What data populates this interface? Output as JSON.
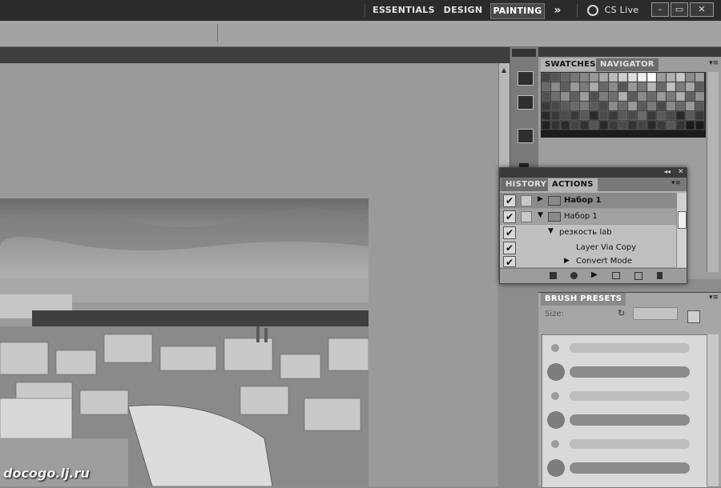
{
  "workspace": {
    "buttons": [
      {
        "label": "ESSENTIALS"
      },
      {
        "label": "DESIGN"
      },
      {
        "label": "PAINTING"
      }
    ],
    "overflow": "»",
    "cslive": "CS Live",
    "window_controls": {
      "minimize": "–",
      "restore": "▭",
      "close": "✕"
    }
  },
  "swatches_panel": {
    "tabs": [
      "SWATCHES",
      "NAVIGATOR"
    ]
  },
  "actions_panel": {
    "tabs": [
      "HISTORY",
      "ACTIONS"
    ],
    "rows": [
      {
        "label": "Набор 1",
        "check": "✔"
      },
      {
        "label": "Набор 1",
        "check": "✔"
      },
      {
        "label": "резкость lab",
        "check": "✔"
      },
      {
        "label": "Layer Via Copy",
        "check": "✔"
      },
      {
        "label": "Convert Mode",
        "check": "✔"
      }
    ]
  },
  "brush_presets": {
    "tab": "BRUSH PRESETS",
    "size_label": "Size:"
  },
  "watermark": "docogo.lj.ru"
}
